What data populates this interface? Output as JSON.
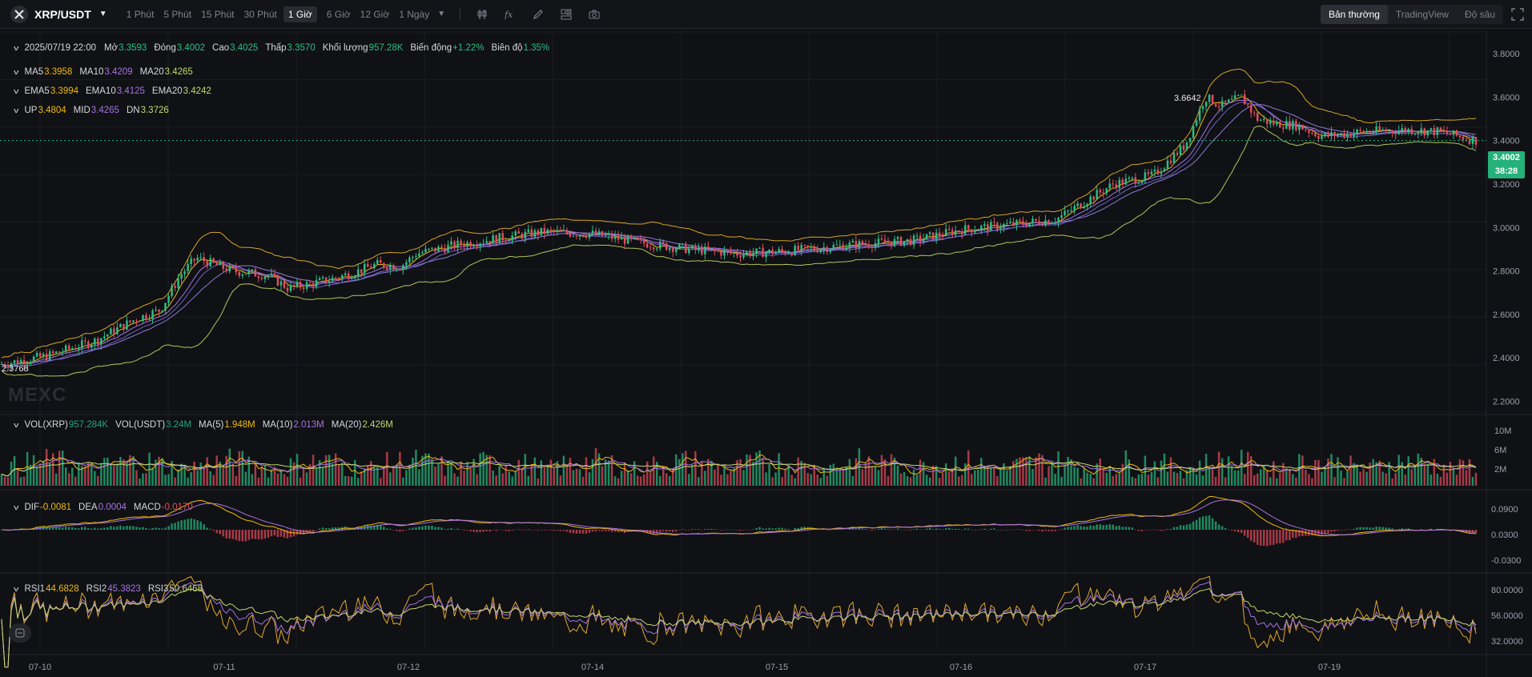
{
  "toolbar": {
    "symbol": "XRP/USDT",
    "intervals": [
      "1 Phút",
      "5 Phút",
      "15 Phút",
      "30 Phút",
      "1 Giờ",
      "6 Giờ",
      "12 Giờ",
      "1 Ngày"
    ],
    "active_interval": "1 Giờ",
    "modes": [
      "Bản thường",
      "TradingView",
      "Độ sâu"
    ],
    "active_mode": "Bản thường",
    "icons": [
      "indicator-icon",
      "formula-icon",
      "draw-pencil-icon",
      "layout-grid-icon",
      "camera-icon",
      "fullscreen-icon"
    ]
  },
  "ohlc": {
    "datetime": "2025/07/19 22:00",
    "open_label": "Mở",
    "open": "3.3593",
    "close_label": "Đóng",
    "close": "3.4002",
    "high_label": "Cao",
    "high": "3.4025",
    "low_label": "Thấp",
    "low": "3.3570",
    "vol_label": "Khối lượng",
    "vol": "957.28K",
    "change_label": "Biến động",
    "change": "+1.22%",
    "amp_label": "Biên độ",
    "amp": "1.35%"
  },
  "ma": {
    "ma5_label": "MA5",
    "ma5": "3.3958",
    "ma10_label": "MA10",
    "ma10": "3.4209",
    "ma20_label": "MA20",
    "ma20": "3.4265"
  },
  "ema": {
    "ema5_label": "EMA5",
    "ema5": "3.3994",
    "ema10_label": "EMA10",
    "ema10": "3.4125",
    "ema20_label": "EMA20",
    "ema20": "3.4242"
  },
  "boll": {
    "up_label": "UP",
    "up": "3.4804",
    "mid_label": "MID",
    "mid": "3.4265",
    "dn_label": "DN",
    "dn": "3.3726"
  },
  "vol": {
    "vol_xrp_label": "VOL(XRP)",
    "vol_xrp": "957.284K",
    "vol_usdt_label": "VOL(USDT)",
    "vol_usdt": "3.24M",
    "ma5_label": "MA(5)",
    "ma5": "1.948M",
    "ma10_label": "MA(10)",
    "ma10": "2.013M",
    "ma20_label": "MA(20)",
    "ma20": "2.426M"
  },
  "macd": {
    "dif_label": "DIF",
    "dif": "-0.0081",
    "dea_label": "DEA",
    "dea": "0.0004",
    "macd_label": "MACD",
    "macd": "-0.0170"
  },
  "rsi": {
    "rsi1_label": "RSI1",
    "rsi1": "44.6828",
    "rsi2_label": "RSI2",
    "rsi2": "45.3823",
    "rsi3_label": "RSI3",
    "rsi3": "50.6468"
  },
  "price_tag": {
    "price": "3.4002",
    "countdown": "38:28"
  },
  "high_marker": "3.6642",
  "low_marker": "2.3768",
  "watermark": "MEXC",
  "price_axis": [
    "3.8000",
    "3.6000",
    "3.4000",
    "3.2000",
    "3.0000",
    "2.8000",
    "2.6000",
    "2.4000",
    "2.2000"
  ],
  "volume_axis": [
    "10M",
    "6M",
    "2M"
  ],
  "macd_axis": [
    "0.0900",
    "0.0300",
    "-0.0300"
  ],
  "rsi_axis": [
    "80.0000",
    "56.0000",
    "32.0000"
  ],
  "time_axis": [
    "07-10",
    "07-11",
    "07-12",
    "07-14",
    "07-15",
    "07-16",
    "07-17",
    "07-19"
  ],
  "colors": {
    "up": "#2ebd85",
    "down": "#e04e5e",
    "ma5": "#f0b90b",
    "ma10": "#a473e6",
    "ma20": "#c5d86d",
    "last_price_line": "#25b17a"
  },
  "chart_data": {
    "type": "candlestick",
    "title": "XRP/USDT",
    "interval": "1 Giờ",
    "ylim": [
      2.2,
      3.85
    ],
    "x_tick_labels": [
      "07-10",
      "07-11",
      "07-12",
      "07-14",
      "07-15",
      "07-16",
      "07-17",
      "07-19"
    ],
    "approx_close_path": [
      {
        "x": "07-10",
        "price": 2.38
      },
      {
        "x": "07-11",
        "price": 2.62
      },
      {
        "x": "07-11",
        "price": 2.86
      },
      {
        "x": "07-12",
        "price": 2.74
      },
      {
        "x": "07-14",
        "price": 2.86
      },
      {
        "x": "07-14",
        "price": 2.97
      },
      {
        "x": "07-15",
        "price": 2.87
      },
      {
        "x": "07-16",
        "price": 2.95
      },
      {
        "x": "07-17",
        "price": 3.22
      },
      {
        "x": "07-17",
        "price": 3.6642
      },
      {
        "x": "07-19",
        "price": 3.44
      },
      {
        "x": "07-19",
        "price": 3.4002
      }
    ],
    "last_price": 3.4002,
    "high": 3.6642,
    "low": 2.3768
  }
}
